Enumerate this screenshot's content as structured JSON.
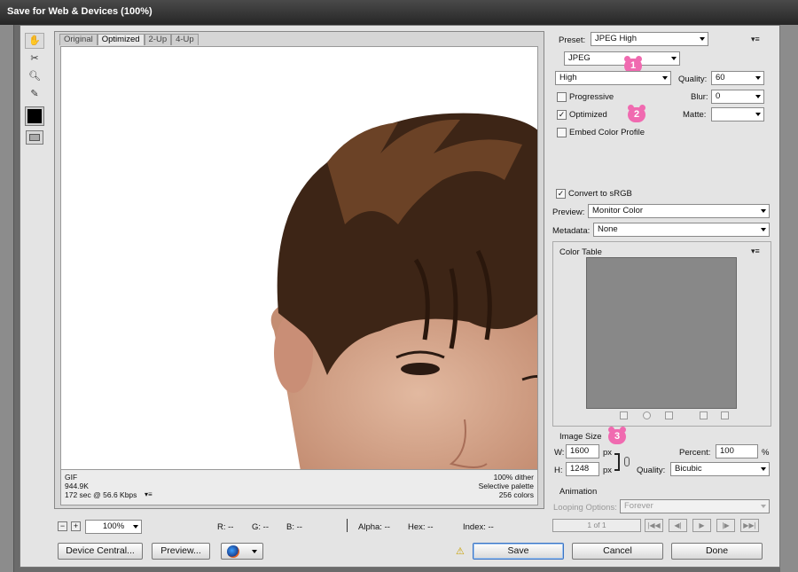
{
  "window": {
    "title": "Save for Web & Devices (100%)"
  },
  "view_tabs": [
    "Original",
    "Optimized",
    "2-Up",
    "4-Up"
  ],
  "image_info": {
    "format": "GIF",
    "size": "944.9K",
    "download_time": "172 sec @ 56.6 Kbps",
    "dither": "100% dither",
    "palette": "Selective palette",
    "colors": "256 colors"
  },
  "zoom": {
    "value": "100%"
  },
  "readout": {
    "r": "R: --",
    "g": "G: --",
    "b": "B: --",
    "alpha": "Alpha: --",
    "hex": "Hex: --",
    "index": "Index: --"
  },
  "buttons": {
    "device_central": "Device Central...",
    "preview": "Preview...",
    "save": "Save",
    "cancel": "Cancel",
    "done": "Done"
  },
  "settings": {
    "preset_label": "Preset:",
    "preset_value": "JPEG High",
    "format_value": "JPEG",
    "quality_mode": "High",
    "quality_label": "Quality:",
    "quality_value": "60",
    "blur_label": "Blur:",
    "blur_value": "0",
    "matte_label": "Matte:",
    "matte_value": "",
    "progressive_label": "Progressive",
    "progressive_checked": false,
    "optimized_label": "Optimized",
    "optimized_checked": true,
    "embed_label": "Embed Color Profile",
    "embed_checked": false,
    "convert_label": "Convert to sRGB",
    "convert_checked": true,
    "preview_label": "Preview:",
    "preview_value": "Monitor Color",
    "metadata_label": "Metadata:",
    "metadata_value": "None",
    "color_table_label": "Color Table",
    "image_size_label": "Image Size",
    "w_label": "W:",
    "w_value": "1600",
    "h_label": "H:",
    "h_value": "1248",
    "px": "px",
    "percent_label": "Percent:",
    "percent_value": "100",
    "percent_unit": "%",
    "resample_label": "Quality:",
    "resample_value": "Bicubic",
    "animation_label": "Animation",
    "looping_label": "Looping Options:",
    "looping_value": "Forever",
    "frame_counter": "1 of 1"
  },
  "badges": [
    "1",
    "2",
    "3"
  ],
  "colors": {
    "badge": "#f06ab0",
    "color_table_bg": "#888888"
  }
}
